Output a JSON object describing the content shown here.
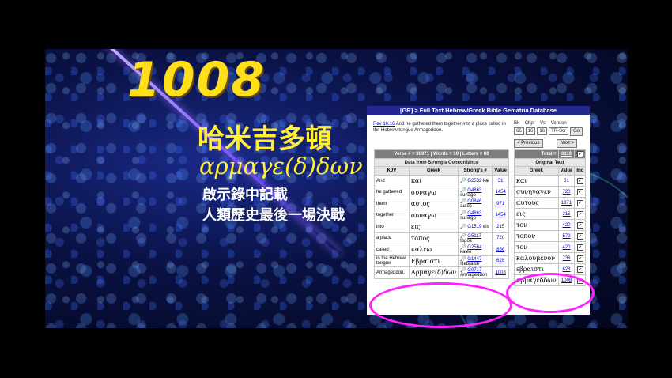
{
  "slide": {
    "number": "1008",
    "chinese_title": "哈米吉多頓",
    "greek_title": "αρμαγε(δ)δων",
    "subtitle_line1": "啟示錄中記載",
    "subtitle_line2": "人類歷史最後一場決戰"
  },
  "panel": {
    "header": "[GR] > Full Text Hebrew/Greek Bible Gematria Database",
    "verse_ref": "Rev 16:16",
    "verse_text": " And he gathered them together into a place called in the Hebrew tongue Armageddon.",
    "controls": {
      "labels": [
        "Bk",
        "Chpt",
        "Vs",
        "Version"
      ],
      "book": "66",
      "chapter": "16",
      "verse": "16",
      "version": "TR-Scr",
      "go_label": "Go",
      "prev_label": "< Previous",
      "next_label": "Next >"
    },
    "left_table": {
      "summary": "Verse # = 30971   |   Words = 10   |   Letters = 60",
      "subtitle": "Data from Strong's Concordance",
      "headers": [
        "KJV",
        "Greek",
        "Strong's #",
        "Value"
      ],
      "rows": [
        {
          "kjv": "And",
          "greek": "και",
          "strongs": "G2532",
          "translit": "kai",
          "value": "31"
        },
        {
          "kjv": "he gathered",
          "greek": "συναγω",
          "strongs": "G4863",
          "translit": "sunago",
          "value": "1454"
        },
        {
          "kjv": "them",
          "greek": "αυτος",
          "strongs": "G0846",
          "translit": "autos",
          "value": "971"
        },
        {
          "kjv": "together",
          "greek": "συναγω",
          "strongs": "G4863",
          "translit": "sunago",
          "value": "1454"
        },
        {
          "kjv": "into",
          "greek": "εις",
          "strongs": "G1519",
          "translit": "eis",
          "value": "215"
        },
        {
          "kjv": "a place",
          "greek": "τοπος",
          "strongs": "G5117",
          "translit": "topos",
          "value": "720"
        },
        {
          "kjv": "called",
          "greek": "καλεω",
          "strongs": "G2564",
          "translit": "kaleo",
          "value": "856"
        },
        {
          "kjv": "in the Hebrew tongue",
          "greek": "Εβραιστι",
          "strongs": "G1447",
          "translit": "Hebraisti",
          "value": "628"
        },
        {
          "kjv": "Armageddon.",
          "greek": "Αρμαγε(δ)δων",
          "strongs": "G0717",
          "translit": "Armageddon",
          "value": "1008"
        }
      ]
    },
    "right_table": {
      "total_label": "Total =",
      "total_value": "6119",
      "subtitle": "Original Text",
      "headers": [
        "Greek",
        "Value",
        "Inc"
      ],
      "rows": [
        {
          "greek": "και",
          "value": "31"
        },
        {
          "greek": "συνηγαγεν",
          "value": "720"
        },
        {
          "greek": "αυτους",
          "value": "1371"
        },
        {
          "greek": "εις",
          "value": "215"
        },
        {
          "greek": "τον",
          "value": "420"
        },
        {
          "greek": "τοπον",
          "value": "570"
        },
        {
          "greek": "τον",
          "value": "420"
        },
        {
          "greek": "καλουμενον",
          "value": "736"
        },
        {
          "greek": "εβραιστι",
          "value": "628"
        },
        {
          "greek": "αρμαγεδδων",
          "value": "1008"
        }
      ]
    }
  },
  "colors": {
    "title_yellow": "#ffdf1a",
    "header_blue": "#22288f",
    "highlight_magenta": "#ff22ff",
    "link_blue": "#0000cc"
  }
}
